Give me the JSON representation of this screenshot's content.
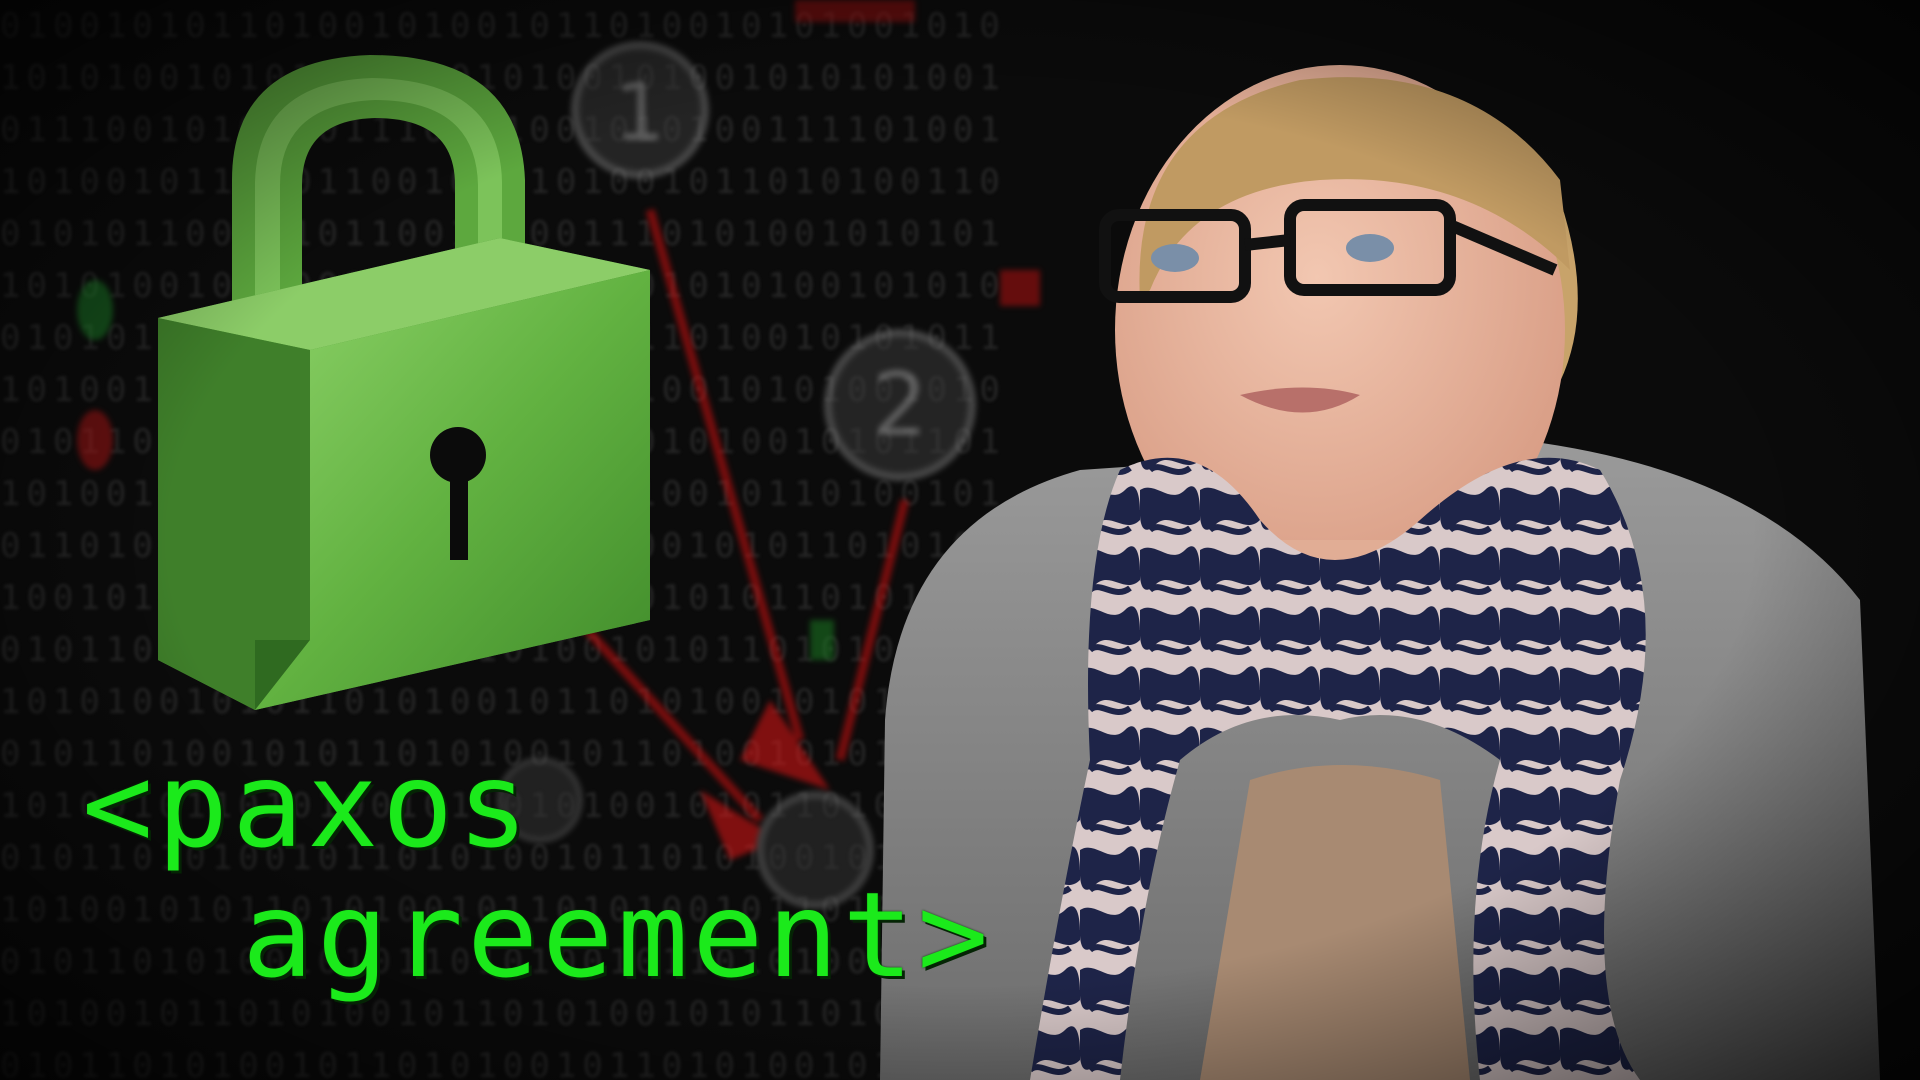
{
  "thumbnail": {
    "title_line1": "<paxos",
    "title_line2": "agreement>",
    "title_color": "#1bea1b",
    "lock_color": "#6fbf4a",
    "diagram_nodes": [
      "1",
      "2"
    ],
    "arrow_color": "#d01010",
    "background_pattern": "binary digits"
  }
}
